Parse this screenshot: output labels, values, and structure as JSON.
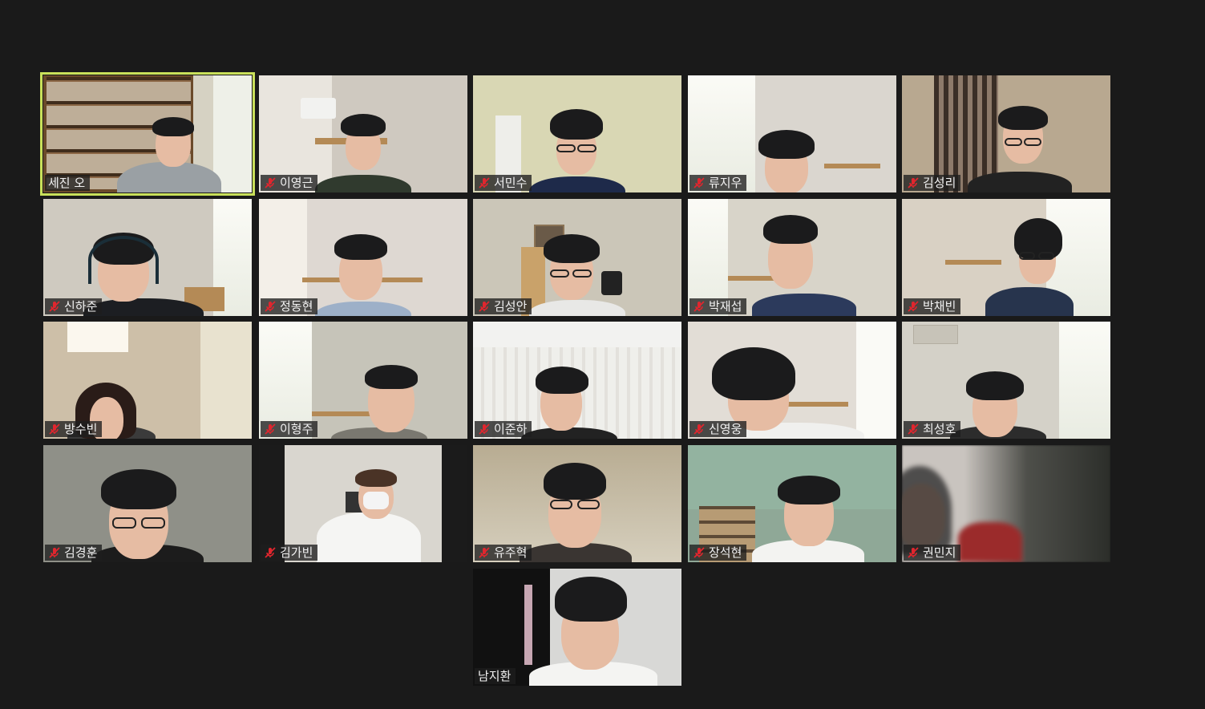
{
  "meeting": {
    "participants": [
      {
        "name": "세진 오",
        "muted": false,
        "active": true
      },
      {
        "name": "이영근",
        "muted": true
      },
      {
        "name": "서민수",
        "muted": true
      },
      {
        "name": "류지우",
        "muted": true
      },
      {
        "name": "김성리",
        "muted": true
      },
      {
        "name": "신하준",
        "muted": true
      },
      {
        "name": "정동현",
        "muted": true
      },
      {
        "name": "김성안",
        "muted": true
      },
      {
        "name": "박재섭",
        "muted": true
      },
      {
        "name": "박채빈",
        "muted": true
      },
      {
        "name": "방수빈",
        "muted": true
      },
      {
        "name": "이형주",
        "muted": true
      },
      {
        "name": "이준하",
        "muted": true
      },
      {
        "name": "신영웅",
        "muted": true
      },
      {
        "name": "최성호",
        "muted": true
      },
      {
        "name": "김경훈",
        "muted": true
      },
      {
        "name": "김가빈",
        "muted": true
      },
      {
        "name": "유주혁",
        "muted": true
      },
      {
        "name": "장석현",
        "muted": true
      },
      {
        "name": "권민지",
        "muted": true
      },
      {
        "name": "남지환",
        "muted": false
      }
    ]
  },
  "colors": {
    "background": "#1a1a1a",
    "active_speaker_border": "#c9e05a",
    "mute_icon": "#e0262e"
  }
}
